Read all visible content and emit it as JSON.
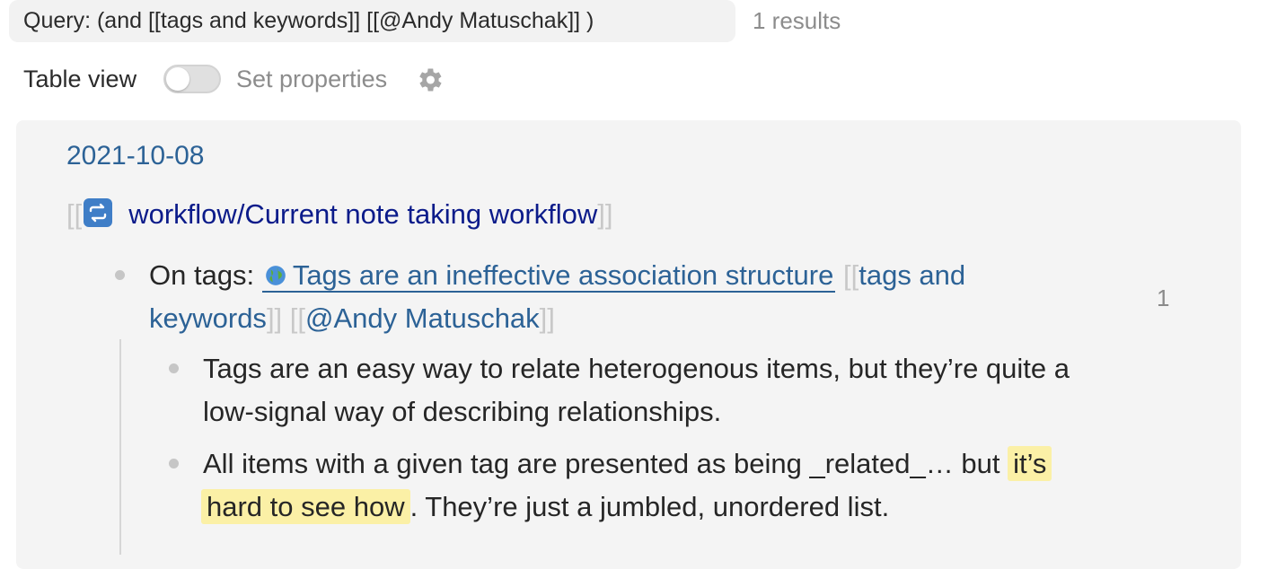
{
  "query": {
    "label": "Query: (and [[tags and keywords]] [[@Andy Matuschak]] )",
    "results": "1 results"
  },
  "controls": {
    "table_view_label": "Table view",
    "table_view_enabled": false,
    "set_properties_label": "Set properties"
  },
  "result": {
    "date": "2021-10-08",
    "page": {
      "open_bracket": "[[",
      "title": "workflow/Current note taking workflow",
      "close_bracket": "]]",
      "icon": "repeat-icon"
    },
    "block": {
      "prefix": "On tags:",
      "block_ref_text": "Tags are an ineffective association structure",
      "block_ref_icon": "globe-icon",
      "tag1_open": "[[",
      "tag1_part1": "tags and",
      "tag1_part2": "keywords",
      "tag1_close": "]]",
      "tag2_open": "[[",
      "tag2": "@Andy Matuschak",
      "tag2_close": "]]",
      "ref_count": "1"
    },
    "children": [
      {
        "line1": "Tags are an easy way to relate heterogenous items, but they’re quite a",
        "line2": "low-signal way of describing relationships."
      },
      {
        "line1_plain": "All items with a given tag are presented as being _related_… but",
        "highlight_part1": "it’s",
        "highlight_part2": "hard to see how",
        "line2_rest": ". They’re just a jumbled, unordered list."
      }
    ]
  },
  "colors": {
    "link": "#2c6296",
    "page_link": "#0b1b8a",
    "highlight": "#fbf0a6",
    "panel_bg": "#f4f4f4"
  }
}
